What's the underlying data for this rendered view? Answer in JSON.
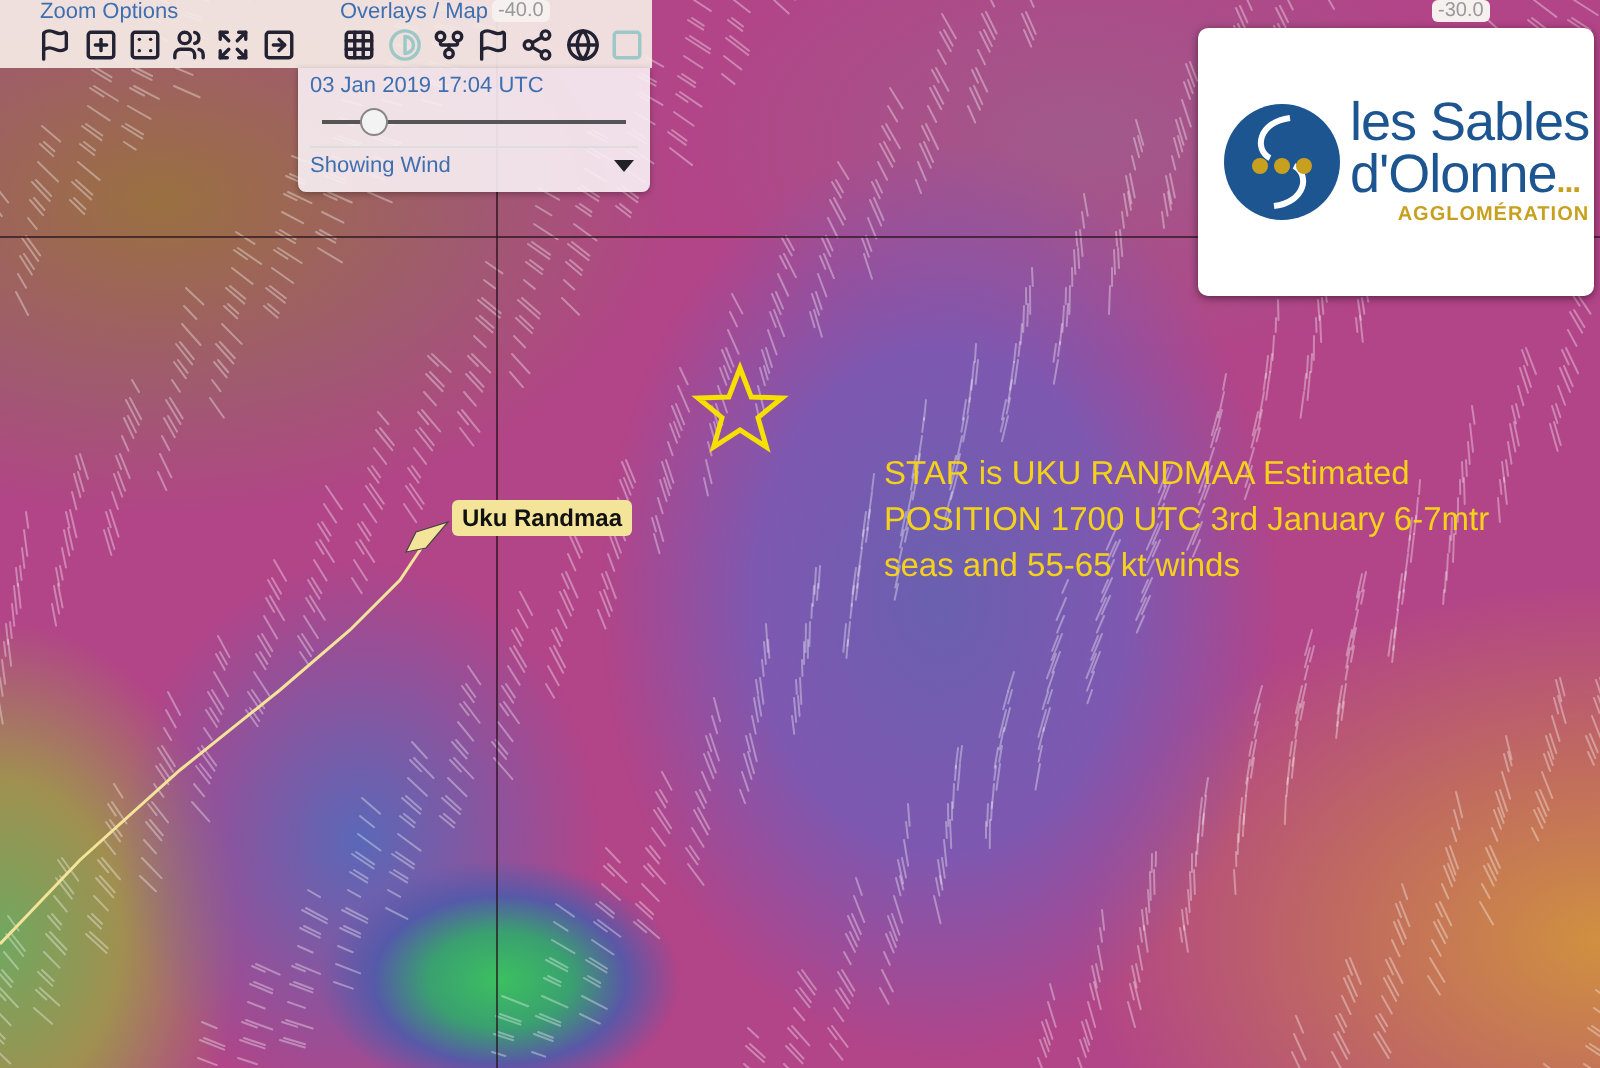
{
  "toolbar": {
    "zoom_group_label": "Zoom Options",
    "overlay_group_label": "Overlays / Map",
    "coordinate_labels": [
      "-40.0",
      "-30.0"
    ]
  },
  "time_panel": {
    "datetime": "03 Jan 2019 17:04 UTC",
    "level": 0.17,
    "dropdown_value": "Showing Wind"
  },
  "boat": {
    "label": "Uku Randmaa"
  },
  "annotation": {
    "text": "STAR is UKU RANDMAA Estimated POSITION 1700 UTC 3rd January 6-7mtr seas and 55-65 kt winds"
  },
  "logo": {
    "line1": "les Sables",
    "line2": "d'Olonne",
    "ellipsis": "...",
    "subtitle": "AGGLOMÉRATION"
  }
}
